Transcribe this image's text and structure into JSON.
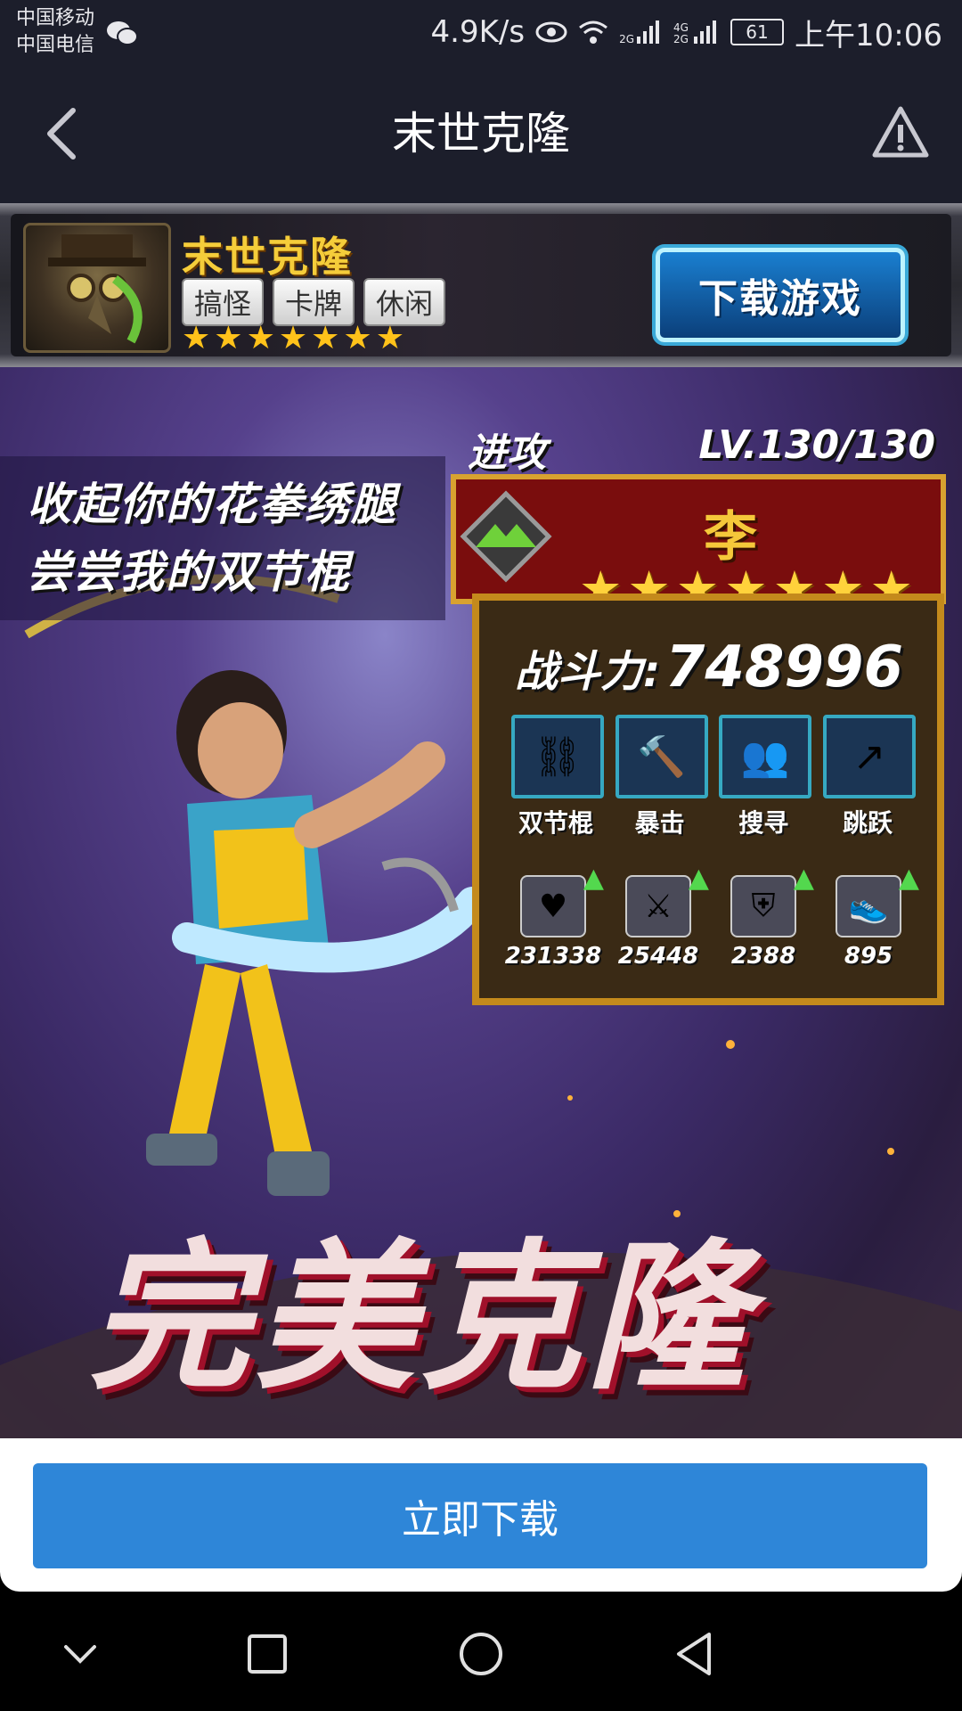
{
  "status_bar": {
    "carrier_1": "中国移动",
    "carrier_2": "中国电信",
    "net_speed": "4.9K/s",
    "network_1": "2G",
    "network_2": "4G 2G",
    "battery": "61",
    "time": "上午10:06"
  },
  "header": {
    "title": "末世克隆"
  },
  "banner": {
    "game_name": "末世克隆",
    "tags": [
      "搞怪",
      "卡牌",
      "休闲"
    ],
    "star_count": 7,
    "download_game_label": "下载游戏"
  },
  "promo": {
    "slogan_line1": "收起你的花拳绣腿",
    "slogan_line2": "尝尝我的双节棍",
    "type_label": "进攻",
    "level": "LV.130/130",
    "hero_name": "李",
    "hero_stars": 7,
    "power_label": "战斗力:",
    "power_value": "748996",
    "skills": [
      {
        "label": "双节棍",
        "icon": "nunchaku-icon"
      },
      {
        "label": "暴击",
        "icon": "hammer-icon"
      },
      {
        "label": "搜寻",
        "icon": "search-people-icon"
      },
      {
        "label": "跳跃",
        "icon": "jump-icon"
      }
    ],
    "stats": [
      {
        "value": "231338",
        "icon": "heart-icon"
      },
      {
        "value": "25448",
        "icon": "sword-icon"
      },
      {
        "value": "2388",
        "icon": "shield-icon"
      },
      {
        "value": "895",
        "icon": "shoe-icon"
      }
    ],
    "big_title": "完美克隆"
  },
  "footer": {
    "download_now_label": "立即下载"
  },
  "colors": {
    "bar_bg": "#1c1e2b",
    "button_blue": "#2e86d8",
    "gold": "#f5c83a"
  }
}
